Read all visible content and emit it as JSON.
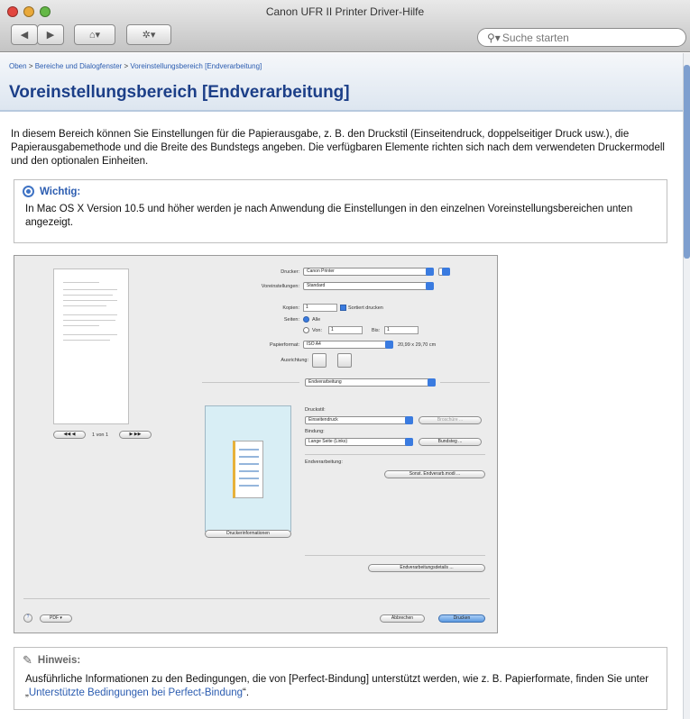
{
  "window": {
    "title": "Canon UFR II Printer Driver-Hilfe"
  },
  "toolbar": {
    "back_glyph": "◀",
    "forward_glyph": "▶",
    "home_glyph": "⌂▾",
    "action_glyph": "✲▾"
  },
  "search": {
    "placeholder": "Suche starten",
    "icon": "search-icon"
  },
  "breadcrumb": {
    "home": "Oben",
    "sep": ">",
    "section": "Bereiche und Dialogfenster",
    "current": "Voreinstellungsbereich [Endverarbeitung]"
  },
  "page": {
    "title": "Voreinstellungsbereich [Endverarbeitung]",
    "intro": "In diesem Bereich können Sie Einstellungen für die Papierausgabe, z. B. den Druckstil (Einseitendruck, doppelseitiger Druck usw.), die Papierausgabemethode und die Breite des Bundstegs angeben. Die verfügbaren Elemente richten sich nach dem verwendeten Druckermodell und den optionalen Einheiten."
  },
  "important": {
    "heading": "Wichtig:",
    "text": "In Mac OS X Version 10.5 und höher werden je nach Anwendung die Einstellungen in den einzelnen Voreinstellungsbereichen unten angezeigt."
  },
  "dialog": {
    "printer_label": "Drucker:",
    "printer_value": "Canon Printer",
    "presets_label": "Voreinstellungen:",
    "presets_value": "Standard",
    "copies_label": "Kopien:",
    "copies_value": "1",
    "collate_label": "Sortiert drucken",
    "pages_label": "Seiten:",
    "pages_all": "Alle",
    "pages_from": "Von:",
    "from_value": "1",
    "pages_to": "Bis:",
    "to_value": "1",
    "paper_label": "Papierformat:",
    "paper_value": "ISO A4",
    "paper_size": "20,99 x 29,70 cm",
    "orient_label": "Ausrichtung:",
    "pane_value": "Endverarbeitung",
    "print_style_label": "Druckstil:",
    "print_style_value": "Einseitendruck",
    "booklet_btn": "Broschüre ...",
    "binding_label": "Bindung:",
    "binding_value": "Lange Seite (Links)",
    "gutter_btn": "Bundsteg ...",
    "finishing_label": "Endverarbeitung:",
    "finishing_btn": "Sonst. Endverarb.modi ...",
    "printer_info_btn": "Druckerinformationen",
    "finishing_details_btn": "Endverarbeitungsdetails ...",
    "page_nav": "1 von 1",
    "help_glyph": "?",
    "pdf_btn": "PDF ▾",
    "cancel_btn": "Abbrechen",
    "print_btn": "Drucken"
  },
  "note": {
    "heading": "Hinweis:",
    "text_before": "Ausführliche Informationen zu den Bedingungen, die von [Perfect-Bindung] unterstützt werden, wie z. B. Papierformate, finden Sie unter „",
    "link": "Unterstützte Bedingungen bei Perfect-Bindung",
    "text_after": "“."
  },
  "colors": {
    "link": "#2b5cb0",
    "title": "#1c3f88",
    "close": "#e2463f",
    "minimize": "#e9a93a",
    "zoom": "#64b846"
  }
}
